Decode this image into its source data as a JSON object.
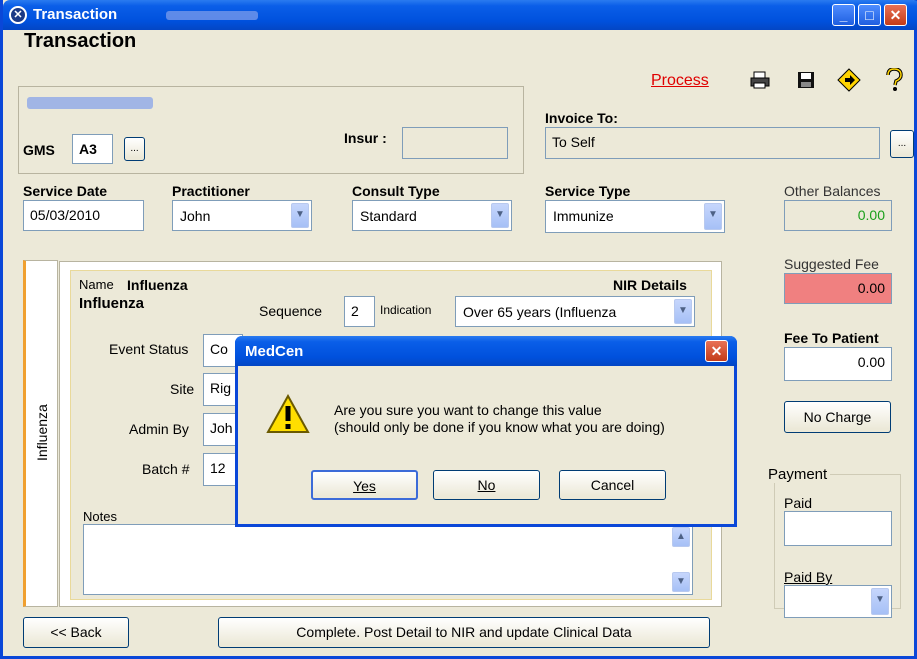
{
  "window": {
    "title": "Transaction",
    "heading": "Transaction",
    "colors": {
      "titlebar": "#0054e3",
      "accent": "#e00000",
      "warning_field": "#f08080",
      "balance_text": "#1aa01a"
    }
  },
  "header": {
    "process_link": "Process",
    "tools": [
      "print-icon",
      "save-icon",
      "navigate-icon",
      "help-icon"
    ],
    "gms_label": "GMS",
    "gms_value": "A3",
    "ellipsis": "...",
    "insur_label": "Insur :",
    "invoice_label": "Invoice To:",
    "invoice_value": "To Self"
  },
  "service": {
    "date_label": "Service Date",
    "date_value": "05/03/2010",
    "practitioner_label": "Practitioner",
    "practitioner_value": "John",
    "consult_label": "Consult Type",
    "consult_value": "Standard",
    "service_type_label": "Service Type",
    "service_type_value": "Immunize"
  },
  "balances": {
    "other_label": "Other Balances",
    "other_value": "0.00",
    "suggested_label": "Suggested Fee",
    "suggested_value": "0.00",
    "fee_label": "Fee To Patient",
    "fee_value": "0.00",
    "no_charge": "No Charge"
  },
  "payment": {
    "legend": "Payment",
    "paid_label": "Paid",
    "paid_value": "",
    "paid_by_label": "Paid By",
    "paid_by_value": ""
  },
  "detail": {
    "tab": "Influenza",
    "name_label": "Name",
    "name_value": "Influenza",
    "subtitle": "Influenza",
    "nir_label": "NIR Details",
    "sequence_label": "Sequence",
    "sequence_value": "2",
    "indication_label": "Indication",
    "indication_value": "Over 65 years (Influenza",
    "event_status_label": "Event Status",
    "event_status_value": "Co",
    "site_label": "Site",
    "site_value": "Rig",
    "admin_by_label": "Admin By",
    "admin_by_value": "Joh",
    "batch_label": "Batch #",
    "batch_value": "12",
    "notes_label": "Notes"
  },
  "footer": {
    "back": "<< Back",
    "complete": "Complete. Post Detail to NIR and update Clinical Data"
  },
  "dialog": {
    "title": "MedCen",
    "close": "✕",
    "message_line1": "Are you sure you want to change this value",
    "message_line2": "(should only be done if you know what you are doing)",
    "yes": "Yes",
    "no": "No",
    "cancel": "Cancel"
  }
}
